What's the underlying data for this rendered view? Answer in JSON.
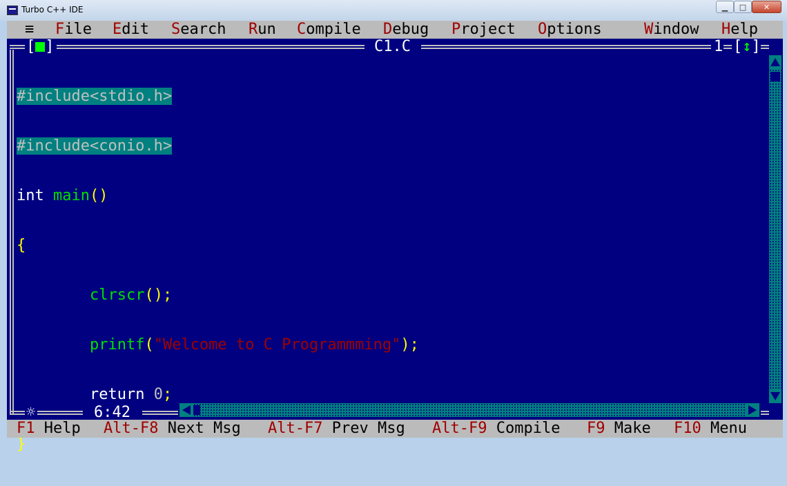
{
  "window": {
    "title": "Turbo C++ IDE",
    "minimize_glyph": "▁",
    "maximize_glyph": "□",
    "close_glyph": "✕"
  },
  "menu": {
    "system_glyph": "≡",
    "items": [
      {
        "hotkey": "F",
        "rest": "ile"
      },
      {
        "hotkey": "E",
        "rest": "dit"
      },
      {
        "hotkey": "S",
        "rest": "earch"
      },
      {
        "hotkey": "R",
        "rest": "un"
      },
      {
        "hotkey": "C",
        "rest": "ompile"
      },
      {
        "hotkey": "D",
        "rest": "ebug"
      },
      {
        "hotkey": "P",
        "rest": "roject"
      },
      {
        "hotkey": "O",
        "rest": "ptions"
      },
      {
        "hotkey": "W",
        "rest": "indow"
      },
      {
        "hotkey": "H",
        "rest": "elp"
      }
    ]
  },
  "editor_window": {
    "filename": "C1.C",
    "window_number": "1",
    "zoom_glyph": "↕",
    "cursor_position": "6:42",
    "modified_glyph": "☼"
  },
  "code": {
    "line1": "#include<stdio.h>",
    "line2": "#include<conio.h>",
    "line3_kw": "int",
    "line3_fn": "main",
    "line3_pun": "()",
    "line4": "{",
    "line5_indent": "        ",
    "line5_fn": "clrscr",
    "line5_pun": "();",
    "line6_fn": "printf",
    "line6_pun_open": "(",
    "line6_str": "\"Welcome to C Programmming\"",
    "line6_pun_close": ");",
    "line7_kw": "return",
    "line7_num": "0",
    "line7_pun": ";",
    "line8": "}"
  },
  "status": [
    {
      "key": "F1",
      "label": "Help"
    },
    {
      "key": "Alt-F8",
      "label": "Next Msg"
    },
    {
      "key": "Alt-F7",
      "label": "Prev Msg"
    },
    {
      "key": "Alt-F9",
      "label": "Compile"
    },
    {
      "key": "F9",
      "label": "Make"
    },
    {
      "key": "F10",
      "label": "Menu"
    }
  ],
  "colors": {
    "background": "#000080",
    "menu_bg": "#bbbbbb",
    "hotkey": "#a00000",
    "selection": "#008080",
    "function": "#00e000",
    "punctuation": "#ffff00",
    "string": "#a00000"
  }
}
